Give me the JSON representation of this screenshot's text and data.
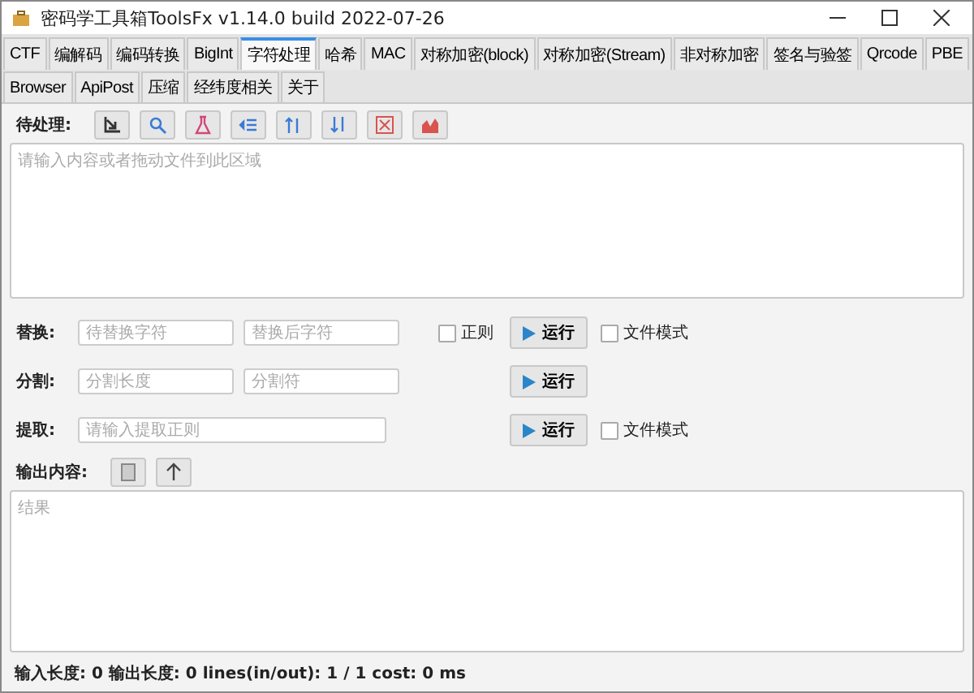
{
  "window": {
    "title": "密码学工具箱ToolsFx v1.14.0 build 2022-07-26"
  },
  "tabs": [
    {
      "label": "CTF",
      "selected": false
    },
    {
      "label": "编解码",
      "selected": false
    },
    {
      "label": "编码转换",
      "selected": false
    },
    {
      "label": "BigInt",
      "selected": false
    },
    {
      "label": "字符处理",
      "selected": true
    },
    {
      "label": "哈希",
      "selected": false
    },
    {
      "label": "MAC",
      "selected": false
    },
    {
      "label": "对称加密(block)",
      "selected": false
    },
    {
      "label": "对称加密(Stream)",
      "selected": false
    },
    {
      "label": "非对称加密",
      "selected": false
    },
    {
      "label": "签名与验签",
      "selected": false
    },
    {
      "label": "Qrcode",
      "selected": false
    },
    {
      "label": "PBE",
      "selected": false
    },
    {
      "label": "Browser",
      "selected": false
    },
    {
      "label": "ApiPost",
      "selected": false
    },
    {
      "label": "压缩",
      "selected": false
    },
    {
      "label": "经纬度相关",
      "selected": false
    },
    {
      "label": "关于",
      "selected": false
    }
  ],
  "input": {
    "label": "待处理:",
    "placeholder": "请输入内容或者拖动文件到此区域"
  },
  "toolbar": [
    {
      "kind": "import"
    },
    {
      "kind": "search"
    },
    {
      "kind": "flask"
    },
    {
      "kind": "indent"
    },
    {
      "kind": "sort-up"
    },
    {
      "kind": "sort-down"
    },
    {
      "kind": "image"
    },
    {
      "kind": "chart"
    }
  ],
  "rows": [
    {
      "label": "替换:",
      "fields": [
        {
          "placeholder": "待替换字符"
        },
        {
          "placeholder": "替换后字符"
        }
      ],
      "regex": {
        "label": "正则",
        "checked": false
      },
      "run": "运行",
      "file_mode": {
        "label": "文件模式",
        "checked": false
      }
    },
    {
      "label": "分割:",
      "fields": [
        {
          "placeholder": "分割长度"
        },
        {
          "placeholder": "分割符"
        }
      ],
      "run": "运行"
    },
    {
      "label": "提取:",
      "fields": [
        {
          "placeholder": "请输入提取正则"
        }
      ],
      "run": "运行",
      "file_mode": {
        "label": "文件模式",
        "checked": false
      }
    }
  ],
  "output": {
    "label": "输出内容:",
    "placeholder": "结果"
  },
  "status_bar": "输入长度: 0  输出长度: 0 lines(in/out): 1 / 1 cost: 0 ms"
}
